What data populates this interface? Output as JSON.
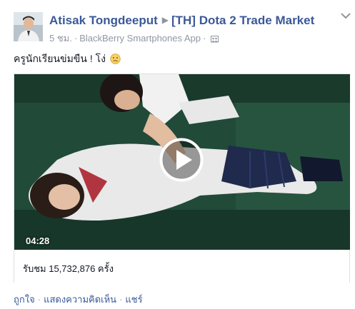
{
  "post": {
    "author": "Atisak Tongdeeput",
    "group": "[TH] Dota 2 Trade Market",
    "time": "5 ชม.",
    "meta_separator": "·",
    "source": "BlackBerry Smartphones App",
    "text": "ครูนักเรียนข่มขืน ! โง่",
    "emoji_icon": "confused-face-icon"
  },
  "video": {
    "duration": "04:28",
    "views": "รับชม 15,732,876 ครั้ง"
  },
  "actions": {
    "like": "ถูกใจ",
    "comment": "แสดงความคิดเห็น",
    "share": "แชร์",
    "separator": "·"
  },
  "colors": {
    "link": "#3b5998",
    "meta": "#9197a3",
    "text": "#141823",
    "border": "#dddfe2"
  }
}
